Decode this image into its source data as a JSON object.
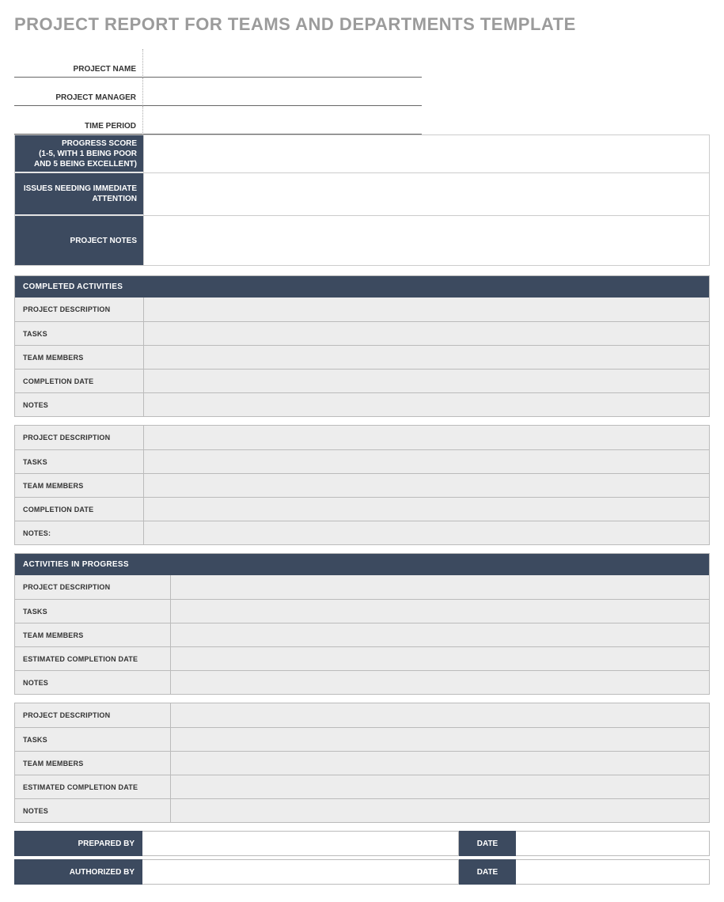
{
  "title": "PROJECT REPORT FOR TEAMS AND DEPARTMENTS TEMPLATE",
  "top": {
    "project_name": {
      "label": "PROJECT NAME",
      "value": ""
    },
    "project_manager": {
      "label": "PROJECT MANAGER",
      "value": ""
    },
    "time_period": {
      "label": "TIME PERIOD",
      "value": ""
    }
  },
  "highlights": {
    "progress_score": {
      "label": "PROGRESS SCORE\n(1-5, WITH 1 BEING POOR AND 5 BEING EXCELLENT)",
      "value": ""
    },
    "issues": {
      "label": "ISSUES NEEDING IMMEDIATE ATTENTION",
      "value": ""
    },
    "project_notes": {
      "label": "PROJECT NOTES",
      "value": ""
    }
  },
  "completed": {
    "header": "COMPLETED ACTIVITIES",
    "blocks": [
      {
        "rows": [
          {
            "label": "PROJECT DESCRIPTION",
            "value": ""
          },
          {
            "label": "TASKS",
            "value": ""
          },
          {
            "label": "TEAM MEMBERS",
            "value": ""
          },
          {
            "label": "COMPLETION DATE",
            "value": ""
          },
          {
            "label": "NOTES",
            "value": ""
          }
        ]
      },
      {
        "rows": [
          {
            "label": "PROJECT DESCRIPTION",
            "value": ""
          },
          {
            "label": "TASKS",
            "value": ""
          },
          {
            "label": "TEAM MEMBERS",
            "value": ""
          },
          {
            "label": "COMPLETION DATE",
            "value": ""
          },
          {
            "label": "NOTES:",
            "value": ""
          }
        ]
      }
    ]
  },
  "in_progress": {
    "header": "ACTIVITIES IN PROGRESS",
    "blocks": [
      {
        "rows": [
          {
            "label": "PROJECT DESCRIPTION",
            "value": ""
          },
          {
            "label": "TASKS",
            "value": ""
          },
          {
            "label": "TEAM MEMBERS",
            "value": ""
          },
          {
            "label": "ESTIMATED COMPLETION DATE",
            "value": ""
          },
          {
            "label": "NOTES",
            "value": ""
          }
        ]
      },
      {
        "rows": [
          {
            "label": "PROJECT DESCRIPTION",
            "value": ""
          },
          {
            "label": "TASKS",
            "value": ""
          },
          {
            "label": "TEAM MEMBERS",
            "value": ""
          },
          {
            "label": "ESTIMATED COMPLETION DATE",
            "value": ""
          },
          {
            "label": "NOTES",
            "value": ""
          }
        ]
      }
    ]
  },
  "footer": {
    "prepared_by": {
      "label": "PREPARED BY",
      "value": "",
      "date_label": "DATE",
      "date_value": ""
    },
    "authorized_by": {
      "label": "AUTHORIZED BY",
      "value": "",
      "date_label": "DATE",
      "date_value": ""
    }
  }
}
